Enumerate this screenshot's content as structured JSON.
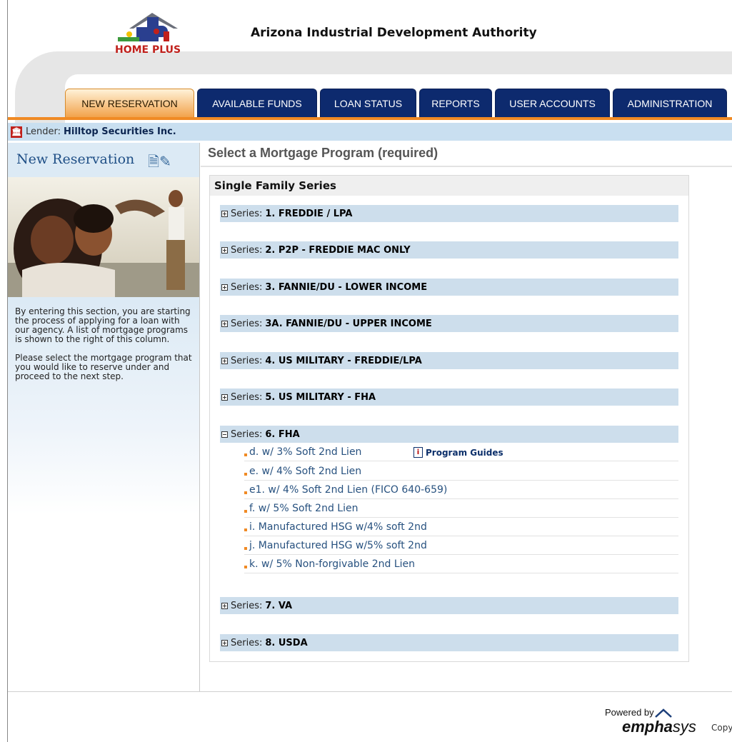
{
  "header": {
    "logo_text": "HOME PLUS",
    "agency_name": "Arizona Industrial Development Authority"
  },
  "tabs": [
    {
      "label": "NEW RESERVATION",
      "active": true
    },
    {
      "label": "AVAILABLE FUNDS",
      "active": false
    },
    {
      "label": "LOAN STATUS",
      "active": false
    },
    {
      "label": "REPORTS",
      "active": false
    },
    {
      "label": "USER ACCOUNTS",
      "active": false
    },
    {
      "label": "ADMINISTRATION",
      "active": false
    }
  ],
  "lender": {
    "label": "Lender:",
    "name": "Hilltop Securities Inc."
  },
  "sidebar": {
    "title": "New Reservation",
    "paragraph1": "By entering this section, you are starting the process of applying for a loan with our agency. A list of mortgage programs is shown to the right of this column.",
    "paragraph2": "Please select the mortgage program that you would like to reserve under and proceed to the next step."
  },
  "main": {
    "title": "Select a Mortgage Program (required)",
    "panel_title": "Single Family Series",
    "series_prefix": "Series:",
    "series": [
      {
        "name": "1. FREDDIE / LPA",
        "expanded": false
      },
      {
        "name": "2. P2P - FREDDIE MAC ONLY",
        "expanded": false
      },
      {
        "name": "3. FANNIE/DU - LOWER INCOME",
        "expanded": false
      },
      {
        "name": "3A. FANNIE/DU - UPPER INCOME",
        "expanded": false
      },
      {
        "name": "4. US MILITARY - FREDDIE/LPA",
        "expanded": false
      },
      {
        "name": "5. US MILITARY - FHA",
        "expanded": false
      },
      {
        "name": "6. FHA",
        "expanded": true
      },
      {
        "name": "7. VA",
        "expanded": false
      },
      {
        "name": "8. USDA",
        "expanded": false
      }
    ],
    "programs": [
      "d. w/ 3% Soft 2nd Lien",
      "e. w/ 4% Soft 2nd Lien",
      "e1. w/ 4% Soft 2nd Lien (FICO 640-659)",
      "f. w/ 5% Soft 2nd Lien",
      "i. Manufactured HSG w/4% soft 2nd",
      "j. Manufactured HSG w/5% soft 2nd",
      "k. w/ 5% Non-forgivable 2nd Lien"
    ],
    "program_guides_label": "Program Guides"
  },
  "footer": {
    "powered_by": "Powered by",
    "brand_bold": "empha",
    "brand_rest": "sys",
    "copyright": "Copy"
  },
  "colors": {
    "tab_navy": "#0d2a6e",
    "tab_active": "#f2a34b",
    "accent_orange": "#f08a24",
    "series_bar": "#cddeec",
    "link_blue": "#27517f"
  }
}
